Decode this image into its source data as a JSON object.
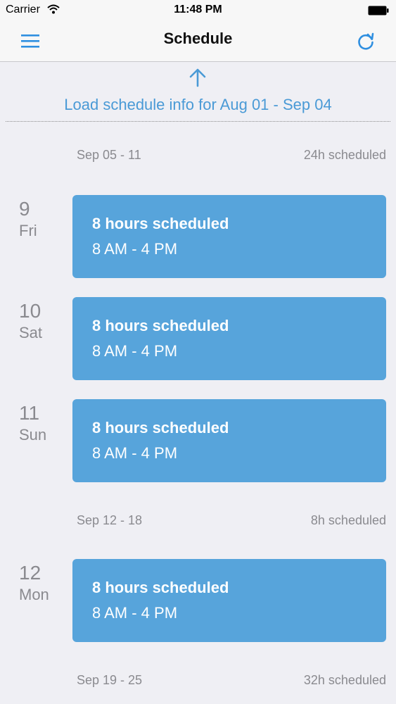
{
  "status_bar": {
    "carrier": "Carrier",
    "time": "11:48 PM"
  },
  "nav": {
    "title": "Schedule",
    "menu_icon": "menu-icon",
    "refresh_icon": "refresh-icon"
  },
  "load_earlier": {
    "label": "Load schedule info for Aug 01 - Sep 04"
  },
  "colors": {
    "accent": "#4a9ad6",
    "card": "#57a4db",
    "background": "#efeff4"
  },
  "weeks": [
    {
      "range": "Sep 05 - 11",
      "total": "24h scheduled"
    },
    {
      "range": "Sep 12 - 18",
      "total": "8h scheduled"
    },
    {
      "range": "Sep 19 - 25",
      "total": "32h scheduled"
    }
  ],
  "days": [
    {
      "day": "9",
      "weekday": "Fri",
      "title": "8 hours scheduled",
      "time": "8 AM - 4 PM"
    },
    {
      "day": "10",
      "weekday": "Sat",
      "title": "8 hours scheduled",
      "time": "8 AM - 4 PM"
    },
    {
      "day": "11",
      "weekday": "Sun",
      "title": "8 hours scheduled",
      "time": "8 AM - 4 PM"
    },
    {
      "day": "12",
      "weekday": "Mon",
      "title": "8 hours scheduled",
      "time": "8 AM - 4 PM"
    }
  ]
}
